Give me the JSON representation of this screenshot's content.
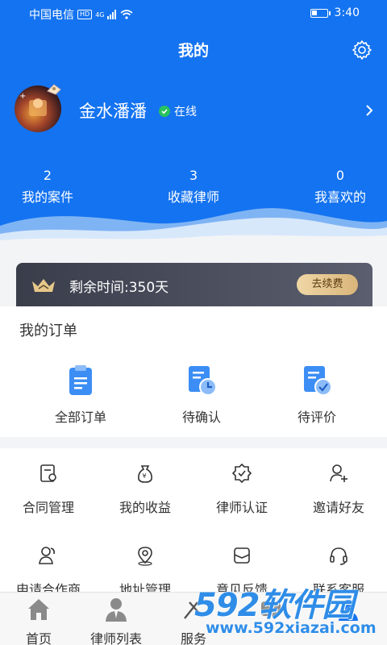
{
  "status_bar": {
    "carrier": "中国电信",
    "hd": "HD",
    "network": "4G",
    "time": "3:40",
    "battery_level": 0.35
  },
  "header": {
    "title": "我的",
    "settings_icon": "gear-icon",
    "background_color": "#1473f0"
  },
  "profile": {
    "username": "金水潘潘",
    "status": "在线",
    "status_color": "#27c25e"
  },
  "stats": [
    {
      "value": "2",
      "label": "我的案件"
    },
    {
      "value": "3",
      "label": "收藏律师"
    },
    {
      "value": "0",
      "label": "我喜欢的"
    }
  ],
  "vip": {
    "remaining": "剩余时间:350天",
    "renew_label": "去续费",
    "icon": "crown-icon"
  },
  "orders": {
    "title": "我的订单",
    "items": [
      {
        "label": "全部订单",
        "icon": "clipboard-icon"
      },
      {
        "label": "待确认",
        "icon": "clock-document-icon"
      },
      {
        "label": "待评价",
        "icon": "check-document-icon"
      }
    ]
  },
  "services": [
    {
      "label": "合同管理",
      "icon": "contract-icon"
    },
    {
      "label": "我的收益",
      "icon": "money-bag-icon"
    },
    {
      "label": "律师认证",
      "icon": "verified-badge-icon"
    },
    {
      "label": "邀请好友",
      "icon": "add-user-icon"
    },
    {
      "label": "申请合作商",
      "icon": "partner-icon"
    },
    {
      "label": "地址管理",
      "icon": "location-icon"
    },
    {
      "label": "意见反馈",
      "icon": "feedback-icon"
    },
    {
      "label": "联系客服",
      "icon": "headset-icon"
    }
  ],
  "tabbar": [
    {
      "label": "首页",
      "icon": "home-icon"
    },
    {
      "label": "律师列表",
      "icon": "lawyer-icon"
    },
    {
      "label": "服务",
      "icon": "service-icon"
    },
    {
      "label": "",
      "icon": "message-icon"
    },
    {
      "label": "",
      "icon": "profile-icon"
    }
  ],
  "watermark": {
    "brand": "592软件园",
    "url": "www.592xiazai.com"
  }
}
